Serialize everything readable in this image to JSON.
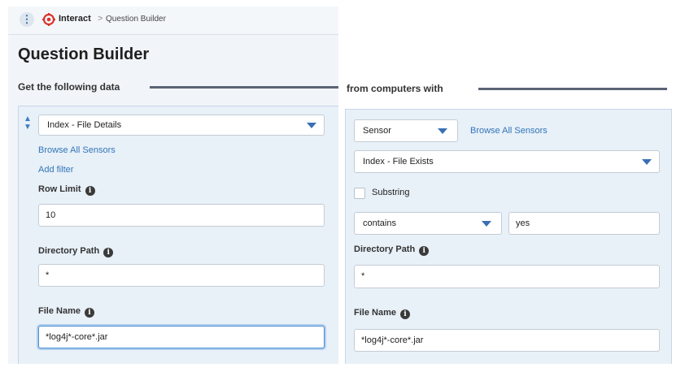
{
  "breadcrumb": {
    "app_name": "Interact",
    "separator": ">",
    "page": "Question Builder"
  },
  "page_title": "Question Builder",
  "left": {
    "section_label": "Get the following data",
    "sensor_select": "Index - File Details",
    "browse_link": "Browse All Sensors",
    "add_filter_link": "Add filter",
    "row_limit_label": "Row Limit",
    "row_limit_value": "10",
    "dir_path_label": "Directory Path",
    "dir_path_value": "*",
    "file_name_label": "File Name",
    "file_name_value": "*log4j*-core*.jar"
  },
  "right": {
    "section_label": "from computers with",
    "type_select": "Sensor",
    "browse_link": "Browse All Sensors",
    "sensor_select": "Index - File Exists",
    "substring_label": "Substring",
    "operator_select": "contains",
    "value_input": "yes",
    "dir_path_label": "Directory Path",
    "dir_path_value": "*",
    "file_name_label": "File Name",
    "file_name_value": "*log4j*-core*.jar"
  },
  "colors": {
    "accent": "#3275b8",
    "card_bg": "#e8f0f8",
    "logo_red": "#d9342b"
  },
  "icons": [
    "kebab-icon",
    "tanium-logo-icon",
    "drag-sort-icon",
    "info-icon",
    "caret-down-icon"
  ]
}
